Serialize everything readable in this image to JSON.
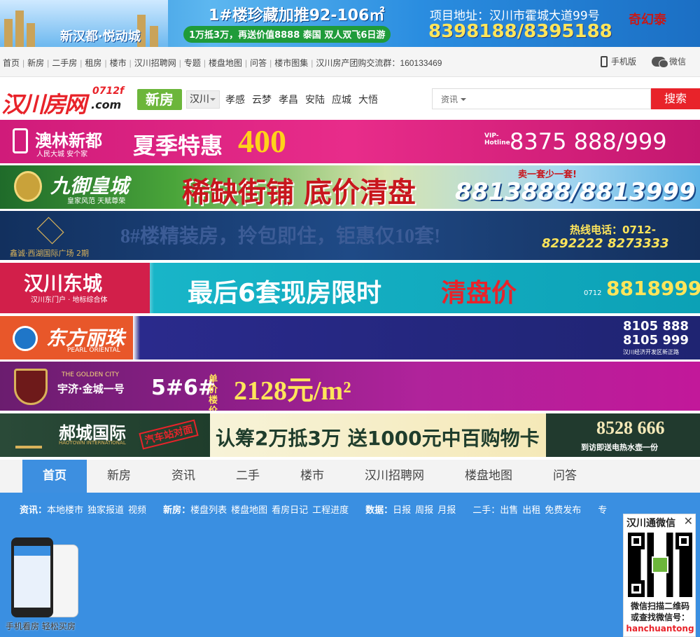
{
  "top_banner": {
    "slogan": "新汉都·悦动城",
    "promo": "1#楼珍藏加推92-106㎡",
    "sub": "1万抵3万，再送价值8888 泰国 双人双飞6日游",
    "address": "项目地址：汉川市霍城大道99号",
    "phone": "8398188/8395188",
    "brand": "奇幻泰"
  },
  "top_nav": {
    "links": [
      "首页",
      "新房",
      "二手房",
      "租房",
      "楼市",
      "汉川招聘网",
      "专题",
      "楼盘地图",
      "问答",
      "楼市图集"
    ],
    "group_text": "汉川房产团购交流群：160133469",
    "mobile_label": "手机版",
    "wechat_label": "微信"
  },
  "header": {
    "logo_text": "汉川房网",
    "logo_sub": "0712f",
    "logo_com": ".com",
    "tag": "新房",
    "city": "汉川",
    "cities": [
      "孝感",
      "云梦",
      "孝昌",
      "安陆",
      "应城",
      "大悟"
    ],
    "search_type": "资讯",
    "search_placeholder": "",
    "search_button": "搜索"
  },
  "ads": {
    "ad1": {
      "brand": "澳林新都",
      "brand_sub": "人民大城 安个家",
      "text": "夏季特惠",
      "amount": "400",
      "hotline_label": "VIP-Hotline",
      "phone": "8375 888/999"
    },
    "ad2": {
      "brand": "九御皇城",
      "brand_sub": "皇家风范 天赋尊荣",
      "text": "稀缺街铺 底价清盘",
      "note": "卖一套少一套!",
      "phone": "8813888/8813999"
    },
    "ad3": {
      "brand": "鑫诚·西湖国际广场 2期",
      "text": "8#楼精装房，拎包即住，钜惠仅10套!",
      "hotline": "热线电话：0712-",
      "phones": "8292222  8273333"
    },
    "ad4": {
      "brand": "汉川东城",
      "brand_sub": "汉川东门户 · 地标综合体",
      "text": "最后6套现房限时",
      "highlight": "清盘价",
      "area_code": "0712",
      "phone": "8818999"
    },
    "ad5": {
      "brand": "东方丽珠",
      "brand_sub": "PEARL ORIENTAL",
      "phone1": "8105 888",
      "phone2": "8105 999",
      "addr": "汉川经济开发区新正路"
    },
    "ad6": {
      "brand_en": "THE GOLDEN CITY",
      "brand": "宇济·金城一号",
      "text": "5#6#",
      "label": "单价楼价",
      "price": "2128元/m²"
    },
    "ad7": {
      "brand": "郝城国际",
      "brand_sub": "HAOTOWN INTERNATIONAL",
      "stamp": "汽车站对面",
      "text": "认筹2万抵3万 送1000元中百购物卡",
      "phone": "8528 666",
      "gift": "到访即送电热水壶一份"
    }
  },
  "main_nav": {
    "tabs": [
      "首页",
      "新房",
      "资讯",
      "二手",
      "楼市",
      "汉川招聘网",
      "楼盘地图",
      "问答"
    ]
  },
  "subnav": {
    "news_label": "资讯：",
    "news": [
      "本地楼市",
      "独家报道",
      "视频"
    ],
    "house_label": "新房：",
    "house": [
      "楼盘列表",
      "楼盘地图",
      "看房日记",
      "工程进度"
    ],
    "data_label": "数据：",
    "data": [
      "日报",
      "周报",
      "月报"
    ],
    "second_label": "二手：",
    "second": [
      "出售",
      "出租",
      "免费发布"
    ],
    "extra": "专"
  },
  "app_promo": {
    "label": "手机看房 轻松买房"
  },
  "qr_box": {
    "title": "汉川通微信",
    "line1": "微信扫描二维码",
    "line2": "或查找微信号：",
    "wechat_id": "hanchuantong"
  }
}
